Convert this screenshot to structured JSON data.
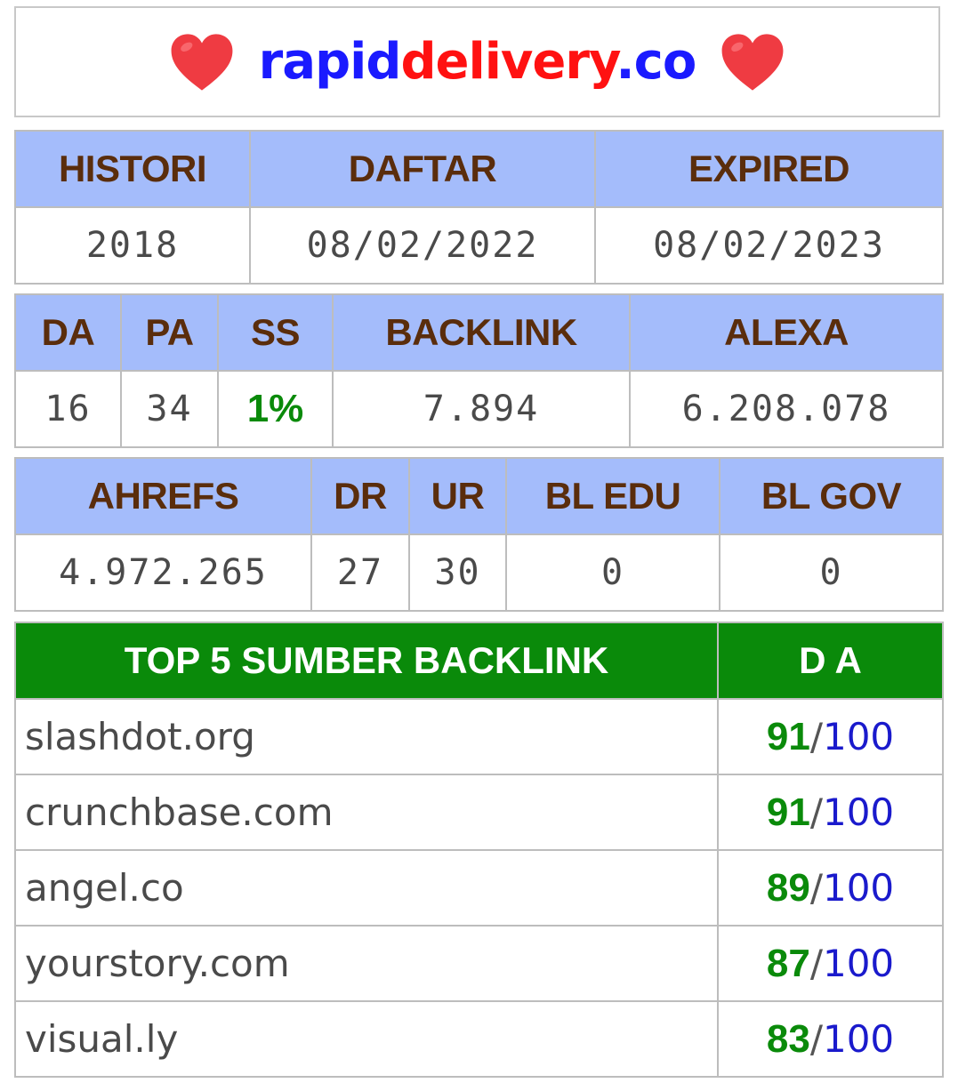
{
  "header": {
    "domain_part1": "rapid",
    "domain_part2": "delivery",
    "domain_part3": ".co",
    "icons": [
      "heart-icon",
      "heart-icon"
    ],
    "colors": {
      "blue": "#1a1aff",
      "red": "#ff1111",
      "heart": "#ef3b42"
    }
  },
  "table1": {
    "headers": [
      "HISTORI",
      "DAFTAR",
      "EXPIRED"
    ],
    "values": [
      "2018",
      "08/02/2022",
      "08/02/2023"
    ]
  },
  "table2": {
    "headers": [
      "DA",
      "PA",
      "SS",
      "BACKLINK",
      "ALEXA"
    ],
    "values": [
      "16",
      "34",
      "1%",
      "7.894",
      "6.208.078"
    ]
  },
  "table3": {
    "headers": [
      "AHREFS",
      "DR",
      "UR",
      "BL EDU",
      "BL GOV"
    ],
    "values": [
      "4.972.265",
      "27",
      "30",
      "0",
      "0"
    ]
  },
  "top_backlinks": {
    "header_source": "TOP 5 SUMBER BACKLINK",
    "header_da": "D A",
    "rows": [
      {
        "site": "slashdot.org",
        "da": "91",
        "max": "100"
      },
      {
        "site": "crunchbase.com",
        "da": "91",
        "max": "100"
      },
      {
        "site": "angel.co",
        "da": "89",
        "max": "100"
      },
      {
        "site": "yourstory.com",
        "da": "87",
        "max": "100"
      },
      {
        "site": "visual.ly",
        "da": "83",
        "max": "100"
      }
    ],
    "colors": {
      "header_bg": "#0a8a0a",
      "score": "#0a8a0a",
      "max": "#1a1acc"
    }
  },
  "colors": {
    "header_bg": "#a4bcfb",
    "header_text": "#5a2d0c"
  }
}
